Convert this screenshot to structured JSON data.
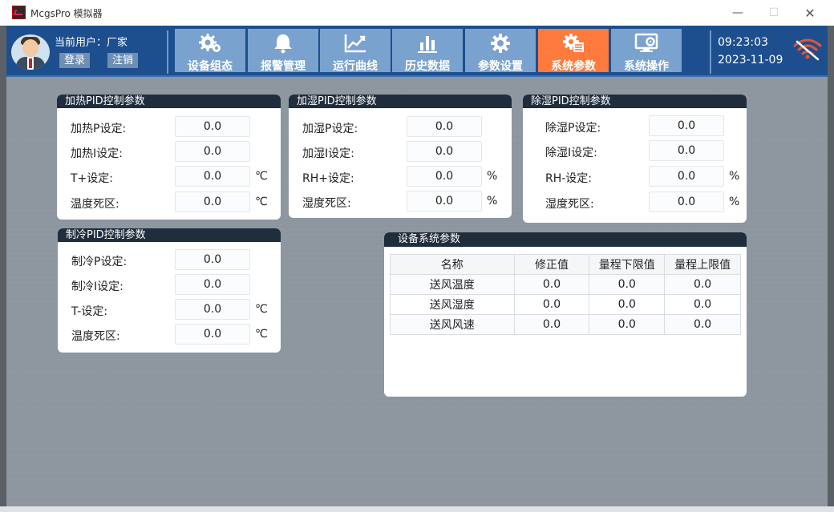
{
  "window": {
    "title": "McgsPro 模拟器",
    "min": "—",
    "max": "☐",
    "close": "✕"
  },
  "user": {
    "label": "当前用户：",
    "name": "厂家",
    "login": "登录",
    "logout": "注销"
  },
  "nav": [
    {
      "label": "设备组态",
      "icon": "gears-icon",
      "active": false
    },
    {
      "label": "报警管理",
      "icon": "bell-icon",
      "active": false
    },
    {
      "label": "运行曲线",
      "icon": "line-chart-icon",
      "active": false
    },
    {
      "label": "历史数据",
      "icon": "bar-chart-icon",
      "active": false
    },
    {
      "label": "参数设置",
      "icon": "gear-icon",
      "active": false
    },
    {
      "label": "系统参数",
      "icon": "system-settings-icon",
      "active": true
    },
    {
      "label": "系统操作",
      "icon": "monitor-settings-icon",
      "active": false
    }
  ],
  "clock": {
    "time": "09:23:03",
    "date": "2023-11-09"
  },
  "network_status_icon": "wifi-disconnected-icon",
  "panels": {
    "heat": {
      "title": "加热PID控制参数",
      "rows": [
        {
          "label": "加热P设定:",
          "value": "0.0",
          "unit": ""
        },
        {
          "label": "加热I设定:",
          "value": "0.0",
          "unit": ""
        },
        {
          "label": "T+设定:",
          "value": "0.0",
          "unit": "℃"
        },
        {
          "label": "温度死区:",
          "value": "0.0",
          "unit": "℃"
        }
      ]
    },
    "humid": {
      "title": "加湿PID控制参数",
      "rows": [
        {
          "label": "加湿P设定:",
          "value": "0.0",
          "unit": ""
        },
        {
          "label": "加湿I设定:",
          "value": "0.0",
          "unit": ""
        },
        {
          "label": "RH+设定:",
          "value": "0.0",
          "unit": "%"
        },
        {
          "label": "湿度死区:",
          "value": "0.0",
          "unit": "%"
        }
      ]
    },
    "dehumid": {
      "title": "除湿PID控制参数",
      "rows": [
        {
          "label": "除湿P设定:",
          "value": "0.0",
          "unit": ""
        },
        {
          "label": "除湿I设定:",
          "value": "0.0",
          "unit": ""
        },
        {
          "label": "RH-设定:",
          "value": "0.0",
          "unit": "%"
        },
        {
          "label": "湿度死区:",
          "value": "0.0",
          "unit": "%"
        }
      ]
    },
    "cool": {
      "title": "制冷PID控制参数",
      "rows": [
        {
          "label": "制冷P设定:",
          "value": "0.0",
          "unit": ""
        },
        {
          "label": "制冷I设定:",
          "value": "0.0",
          "unit": ""
        },
        {
          "label": "T-设定:",
          "value": "0.0",
          "unit": "℃"
        },
        {
          "label": "温度死区:",
          "value": "0.0",
          "unit": "℃"
        }
      ]
    },
    "system": {
      "title": "设备系统参数",
      "columns": [
        "名称",
        "修正值",
        "量程下限值",
        "量程上限值"
      ],
      "rows": [
        [
          "送风温度",
          "0.0",
          "0.0",
          "0.0"
        ],
        [
          "送风湿度",
          "0.0",
          "0.0",
          "0.0"
        ],
        [
          "送风风速",
          "0.0",
          "0.0",
          "0.0"
        ]
      ]
    }
  },
  "colors": {
    "header": "#1d4f8e",
    "nav_button": "#7aa2cf",
    "nav_active": "#ff7a3d",
    "panel_title": "#1f2d3d",
    "background": "#8d969f",
    "wifi_alert": "#e5533a"
  }
}
